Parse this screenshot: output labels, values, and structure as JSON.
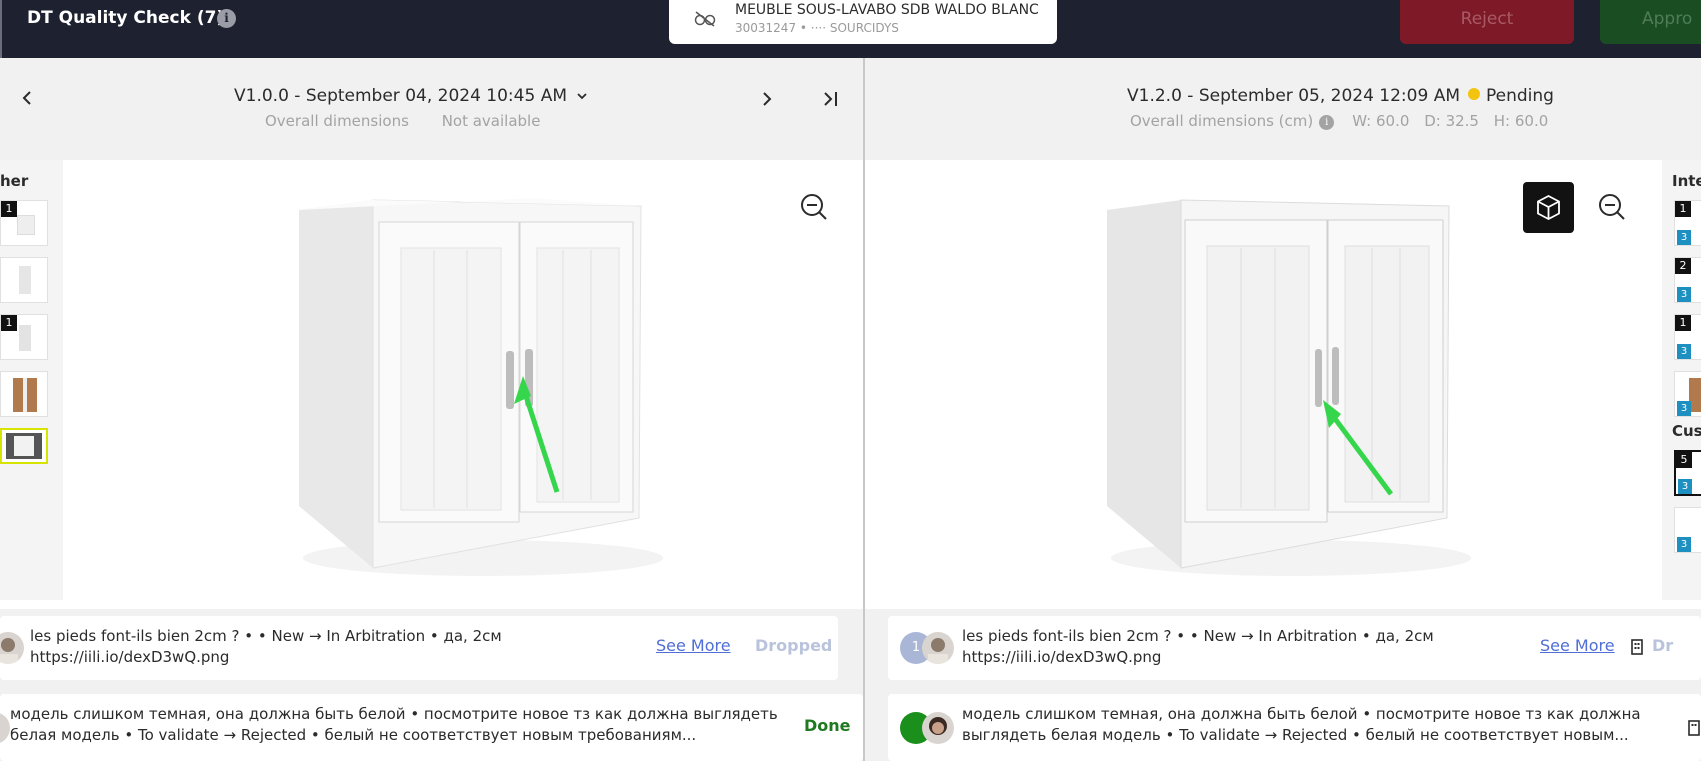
{
  "header": {
    "title": "DT Quality Check (7)",
    "product_name": "MEUBLE SOUS-LAVABO SDB WALDO BLANC",
    "product_meta": "30031247 •   ···· SOURCIDYS",
    "reject_label": "Reject",
    "approve_label": "Appro"
  },
  "left_panel": {
    "version": "V1.0.0 - September 04, 2024 10:45 AM",
    "dims_label": "Overall dimensions",
    "dims_value": "Not available",
    "side_label": "her",
    "thumb_badges": [
      "1",
      "1"
    ],
    "comments": [
      {
        "text_line1": "les pieds font-ils bien 2cm ? • • New → In Arbitration • да, 2см",
        "text_line2": "https://iili.io/dexD3wQ.png",
        "see_more": "See More",
        "status": "Dropped"
      },
      {
        "text_line1": "модель слишком темная, она должна быть белой • посмотрите новое тз как должна выглядеть",
        "text_line2": "белая модель • To validate → Rejected • белый не соответствует новым требованиям...",
        "status": "Done"
      }
    ]
  },
  "right_panel": {
    "version": "V1.2.0 - September 05, 2024 12:09 AM",
    "status": "Pending",
    "dims_label": "Overall dimensions (cm)",
    "dims_w": "W: 60.0",
    "dims_d": "D: 32.5",
    "dims_h": "H: 60.0",
    "side_label_1": "Inte",
    "side_label_2": "Cus",
    "side_badges": [
      "1",
      "2",
      "1",
      "5"
    ],
    "side_sub_badge": "3",
    "comments": [
      {
        "avatar_count": "1",
        "text_line1": "les pieds font-ils bien 2cm ? • • New → In Arbitration • да, 2см",
        "text_line2": "https://iili.io/dexD3wQ.png",
        "see_more": "See More",
        "status_partial": "Dr"
      },
      {
        "text_line1": "модель слишком темная, она должна быть белой • посмотрите новое тз как должна",
        "text_line2": "выглядеть белая модель • To validate → Rejected • белый не соответствует новым..."
      }
    ]
  },
  "icons": {
    "prev": "chevron-left-icon",
    "next": "chevron-right-icon",
    "last": "skip-last-icon",
    "zoom": "zoom-out-icon",
    "cube": "cube-icon",
    "info": "info-icon"
  },
  "colors": {
    "topbar": "#1e2230",
    "reject": "#7e1a27",
    "approve": "#1b4d22",
    "pending": "#f2c40f",
    "link": "#4f6ed6",
    "done": "#1f7a1f",
    "arrow": "#35d64b"
  }
}
